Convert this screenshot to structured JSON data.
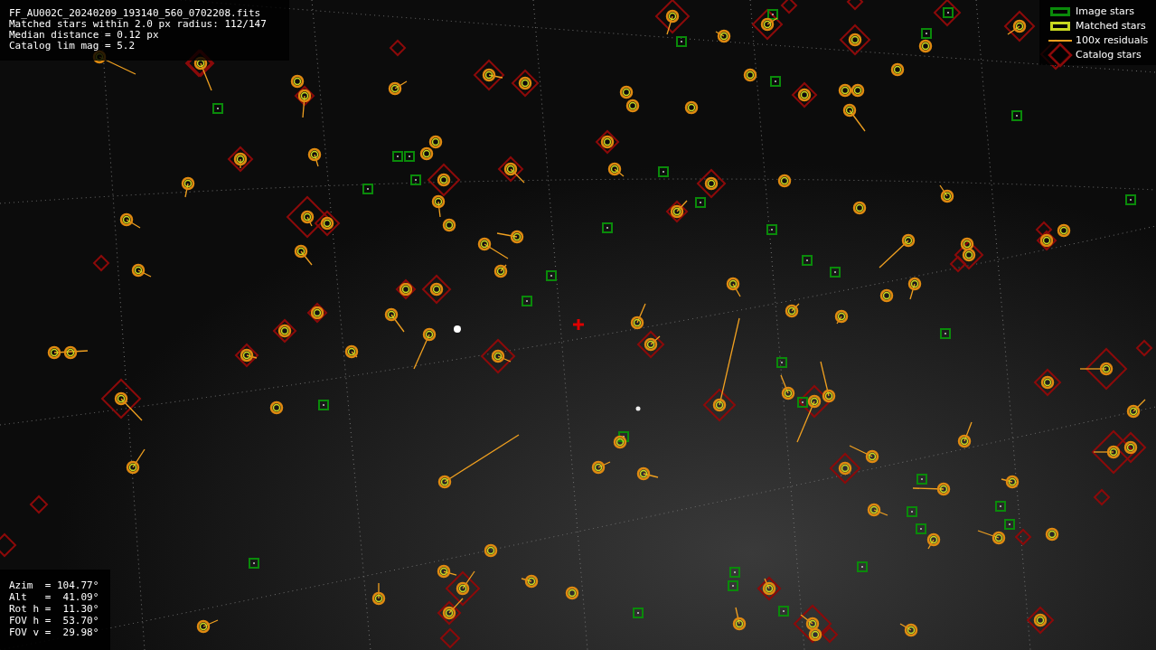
{
  "file_info": {
    "lines": [
      "FF_AU002C_20240209_193140_560_0702208.fits",
      "Matched stars within 2.0 px radius: 112/147",
      "Median distance = 0.12 px",
      "Catalog lim mag = 5.2"
    ]
  },
  "legend": [
    {
      "kind": "image",
      "label": "Image stars"
    },
    {
      "kind": "matched",
      "label": "Matched stars"
    },
    {
      "kind": "residual",
      "label": "100x residuals"
    },
    {
      "kind": "catalog",
      "label": "Catalog stars"
    }
  ],
  "pointing": {
    "lines": [
      "Azim  = 104.77°",
      "Alt   =  41.09°",
      "Rot h =  11.30°",
      "FOV h =  53.70°",
      "FOV v =  29.98°"
    ]
  }
}
